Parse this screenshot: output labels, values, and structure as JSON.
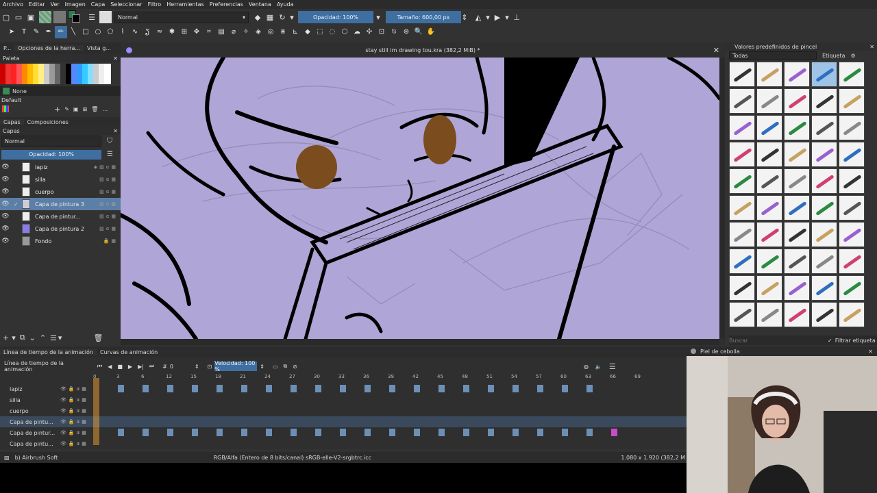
{
  "menu": [
    "Archivo",
    "Editar",
    "Ver",
    "Imagen",
    "Capa",
    "Seleccionar",
    "Filtro",
    "Herramientas",
    "Preferencias",
    "Ventana",
    "Ayuda"
  ],
  "toolbar": {
    "blend_mode": "Normal",
    "opacity": "Opacidad: 100%",
    "size": "Tamaño: 600,00 px"
  },
  "left_tabs": [
    "P...",
    "Opciones de la herra...",
    "Vista g..."
  ],
  "palette": {
    "title": "Paleta",
    "color_name": "None",
    "set_name": "Default"
  },
  "layers_tabs": [
    "Capas",
    "Composiciones"
  ],
  "layers_panel": {
    "title": "Capas",
    "blend": "Normal",
    "opacity": "Opacidad: 100%",
    "items": [
      {
        "name": "lapiz"
      },
      {
        "name": "silla"
      },
      {
        "name": "cuerpo"
      },
      {
        "name": "Capa de pintura 3"
      },
      {
        "name": "Capa de pintur..."
      },
      {
        "name": "Capa de pintura 2"
      },
      {
        "name": "Fondo"
      }
    ]
  },
  "document": {
    "title": "stay still im drawing tou.kra (382,2 MiB) *"
  },
  "brush_presets": {
    "title": "Valores predefinidos de pincel",
    "filter": "Todas",
    "tag_label": "Etiqueta",
    "search_placeholder": "Buscar",
    "filter_tag_label": "Filtrar etiqueta"
  },
  "timeline_tabs": [
    "Línea de tiempo de la animación",
    "Curvas de animación"
  ],
  "timeline": {
    "title": "Línea de tiempo de la animación",
    "frame": "0",
    "speed": "Velocidad: 100 %",
    "frame_numbers": [
      "0",
      "3",
      "6",
      "12",
      "15",
      "18",
      "21",
      "24",
      "27",
      "30",
      "33",
      "36",
      "39",
      "42",
      "45",
      "48",
      "51",
      "54",
      "57",
      "60",
      "63",
      "66",
      "69"
    ],
    "layers": [
      "lapiz",
      "silla",
      "cuerpo",
      "Capa de pintu...",
      "Capa de pintur...",
      "Capa de pintu..."
    ]
  },
  "onion_skin": {
    "title": "Piel de cebolla"
  },
  "status": {
    "brush": "b) Airbrush Soft",
    "color_info": "RGB/Alfa (Entero de 8 bits/canal)  sRGB-elle-V2-srgbtrc.icc",
    "dimensions": "1.080 x 1.920 (382,2 M"
  },
  "colors": {
    "accent": "#3e6fa0",
    "canvas": "#afa5d6",
    "selection": "#5c7fa8",
    "keyframe": "#6c90b5",
    "keyframe_highlight": "#c84bc8"
  }
}
